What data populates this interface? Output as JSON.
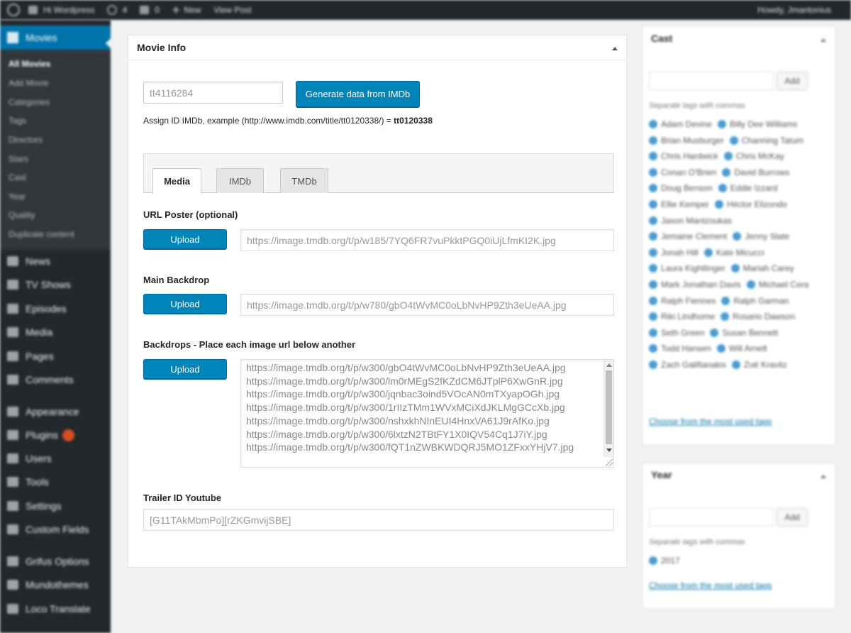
{
  "admin_bar": {
    "site_name": "Hi Wordpress",
    "updates_count": "4",
    "comments_count": "0",
    "new_label": "New",
    "view_post_label": "View Post",
    "howdy": "Howdy, Jmantonius"
  },
  "sidebar": {
    "current_menu": "Movies",
    "submenu": [
      "All Movies",
      "Add Movie",
      "Categories",
      "Tags",
      "Directors",
      "Stars",
      "Cast",
      "Year",
      "Quality",
      "Duplicate content"
    ],
    "menu": [
      "News",
      "TV Shows",
      "Episodes",
      "Media",
      "Pages",
      "Comments",
      "Appearance",
      "Plugins",
      "Users",
      "Tools",
      "Settings",
      "Custom Fields",
      "Grifus Options",
      "Mundothemes",
      "Loco Translate"
    ]
  },
  "movie_info": {
    "title": "Movie Info",
    "imdb_id": "tt4116284",
    "generate_button": "Generate data from IMDb",
    "hint_prefix": "Assign ID IMDb, example (http://www.imdb.com/title/tt0120338/) = ",
    "hint_id": "tt0120338",
    "tabs": [
      {
        "label": "Media"
      },
      {
        "label": "IMDb"
      },
      {
        "label": "TMDb"
      }
    ],
    "poster_label": "URL Poster (optional)",
    "poster_url": "https://image.tmdb.org/t/p/w185/7YQ6FR7vuPkktPGQ0iUjLfmKI2K.jpg",
    "backdrop_label": "Main Backdrop",
    "backdrop_url": "https://image.tmdb.org/t/p/w780/gbO4tWvMC0oLbNvHP9Zth3eUeAA.jpg",
    "backdrops_label": "Backdrops - Place each image url below another",
    "backdrops": [
      "https://image.tmdb.org/t/p/w300/gbO4tWvMC0oLbNvHP9Zth3eUeAA.jpg",
      "https://image.tmdb.org/t/p/w300/lm0rMEgS2fKZdCM6JTplP6XwGnR.jpg",
      "https://image.tmdb.org/t/p/w300/jqnbac3oind5VOcAN0mTXyapOGh.jpg",
      "https://image.tmdb.org/t/p/w300/1rIIzTMm1WVxMCiXdJKLMgGCcXb.jpg",
      "https://image.tmdb.org/t/p/w300/nshxkhNInEUI4HnxVA61J9rAfKo.jpg",
      "https://image.tmdb.org/t/p/w300/6lxtzN2TBtFY1X0IQV54Cq1J7iY.jpg",
      "https://image.tmdb.org/t/p/w300/fQT1nZWBKWDQRJ5MO1ZFxxYHjV7.jpg"
    ],
    "upload_label": "Upload",
    "trailer_label": "Trailer ID Youtube",
    "trailer_value": "[G11TAkMbmPo][rZKGmvijSBE]"
  },
  "cast_box": {
    "title": "Cast",
    "add_label": "Add",
    "hint": "Separate tags with commas",
    "tags": [
      "Adam Devine",
      "Billy Dee Williams",
      "Brian Musburger",
      "Channing Tatum",
      "Chris Hardwick",
      "Chris McKay",
      "Conan O'Brien",
      "David Burrows",
      "Doug Benson",
      "Eddie Izzard",
      "Ellie Kemper",
      "Héctor Elizondo",
      "Jason Mantzoukas",
      "Jemaine Clement",
      "Jenny Slate",
      "Jonah Hill",
      "Kate Micucci",
      "Laura Kightlinger",
      "Mariah Carey",
      "Mark Jonathan Davis",
      "Michael Cera",
      "Ralph Fiennes",
      "Ralph Garman",
      "Riki Lindhome",
      "Rosario Dawson",
      "Seth Green",
      "Susan Bennett",
      "Todd Hansen",
      "Will Arnett",
      "Zach Galifianakis",
      "Zoë Kravitz"
    ],
    "most_used_link": "Choose from the most used tags"
  },
  "year_box": {
    "title": "Year",
    "add_label": "Add",
    "hint": "Separate tags with commas",
    "tags": [
      "2017"
    ],
    "most_used_link": "Choose from the most used tags"
  }
}
